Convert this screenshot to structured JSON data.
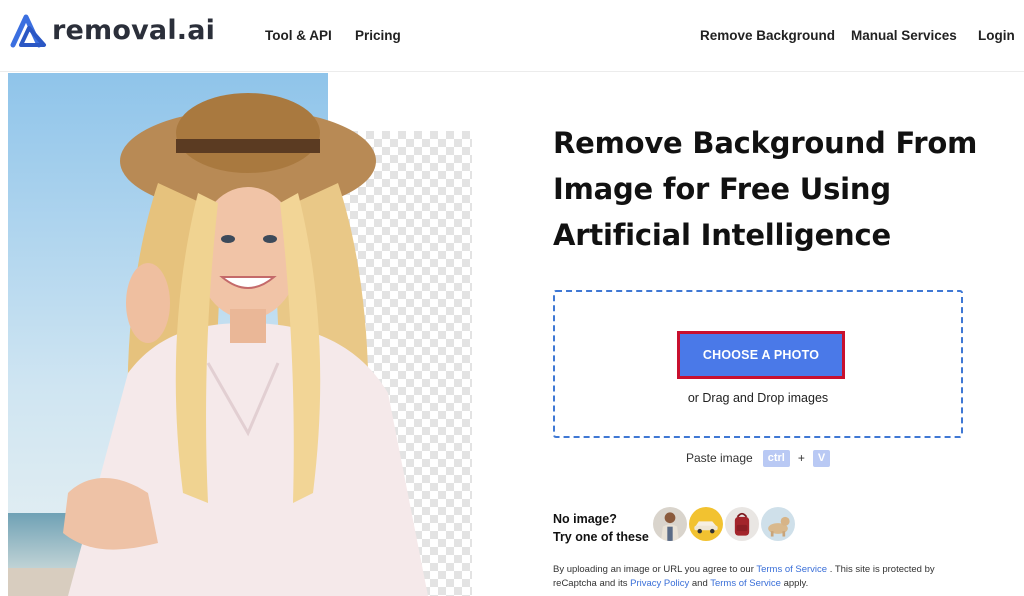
{
  "header": {
    "logo_text": "removal.ai",
    "nav": {
      "tool_api": "Tool & API",
      "pricing": "Pricing",
      "remove_background": "Remove Background",
      "manual_services": "Manual Services",
      "login": "Login"
    }
  },
  "hero": {
    "headline": [
      "Remove Background From",
      "Image for Free Using",
      "Artificial Intelligence"
    ]
  },
  "upload": {
    "button_label": "CHOOSE A PHOTO",
    "drag_text": "or Drag and Drop images",
    "paste_label": "Paste image",
    "key_ctrl": "ctrl",
    "key_plus": "+",
    "key_v": "V"
  },
  "samples": {
    "prompt_line1": "No image?",
    "prompt_line2": "Try one of these",
    "items": [
      "person-sample",
      "car-sample",
      "bag-sample",
      "dog-sample"
    ]
  },
  "legal": {
    "part1": "By uploading an image or URL you agree to our ",
    "terms1": "Terms of Service",
    "part2": " . This site is protected by reCaptcha and its ",
    "privacy": "Privacy Policy",
    "part3": " and ",
    "terms2": "Terms of Service",
    "part4": " apply."
  },
  "colors": {
    "accent": "#4a79e8",
    "button_border": "#c8102e",
    "dropzone_border": "#3f78d4",
    "link": "#3a6fd8"
  }
}
